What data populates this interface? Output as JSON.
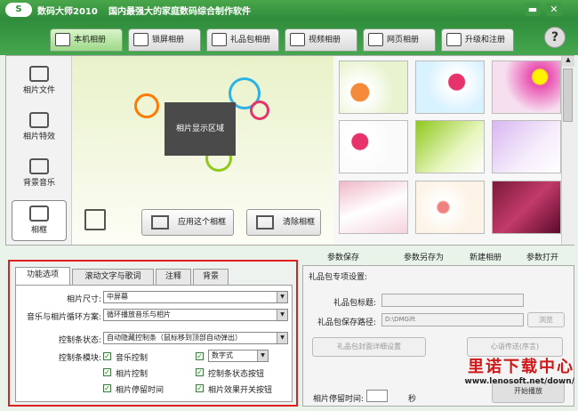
{
  "window": {
    "logo_text": "S",
    "app_name": "数码大师2010",
    "slogan": "国内最强大的家庭数码综合制作软件",
    "min": "▬",
    "close": "✕"
  },
  "tabs": [
    {
      "label": "本机相册",
      "icon": "photo-album-icon",
      "active": true
    },
    {
      "label": "锁屏相册",
      "icon": "monitor-icon",
      "active": false
    },
    {
      "label": "礼品包相册",
      "icon": "gift-icon",
      "active": false
    },
    {
      "label": "视频相册",
      "icon": "film-icon",
      "active": false
    },
    {
      "label": "网页相册",
      "icon": "browser-icon",
      "active": false
    },
    {
      "label": "升级和注册",
      "icon": "globe-icon",
      "active": false
    }
  ],
  "help": "?",
  "sidebar": [
    {
      "label": "相片文件",
      "icon": "camera-icon"
    },
    {
      "label": "相片特效",
      "icon": "sparkle-icon"
    },
    {
      "label": "背景音乐",
      "icon": "music-note-icon"
    },
    {
      "label": "相框",
      "icon": "frame-icon",
      "active": true
    }
  ],
  "preview": {
    "area_label": "相片显示区域",
    "apply_button": "应用这个相框",
    "clear_button": "清除相框"
  },
  "album_toolbar": {
    "save": "参数保存",
    "save_as": "参数另存为",
    "new_album": "新建相册",
    "open": "参数打开"
  },
  "options": {
    "tabs": [
      "功能选项",
      "滚动文字与歌词",
      "注释",
      "背景"
    ],
    "photo_size_label": "相片尺寸:",
    "photo_size_value": "中屏幕",
    "loop_label": "音乐与相片循环方案:",
    "loop_value": "循环播放音乐与相片",
    "control_state_label": "控制条状态:",
    "control_state_value": "自动隐藏控制条（鼠标移到顶部自动弹出）",
    "control_module_label": "控制条模块:",
    "checks": [
      {
        "label": "音乐控制",
        "checked": true
      },
      {
        "label": "相片控制",
        "checked": true
      },
      {
        "label": "相片停留时间",
        "checked": true
      },
      {
        "label": "控制条状态按钮",
        "checked": true
      },
      {
        "label": "相片效果开关按钮",
        "checked": true
      }
    ],
    "digit_style_value": "数字式"
  },
  "gift": {
    "title": "礼品包专项设置:",
    "title_field_label": "礼品包标题:",
    "path_label": "礼品包保存路径:",
    "path_value": "D:\\DMGift",
    "browse": "浏览",
    "cover_button": "礼品包封面详细设置",
    "heart_button": "心语传送(序言)",
    "stay_label": "相片停留时间:",
    "seconds": "秒",
    "start_button": "开始播放"
  },
  "watermark": {
    "line1": "里诺下载中心",
    "line2": "www.lenosoft.net/down/"
  },
  "colors": {
    "title_green": "#2e8b3a",
    "highlight_red": "#e02020"
  }
}
